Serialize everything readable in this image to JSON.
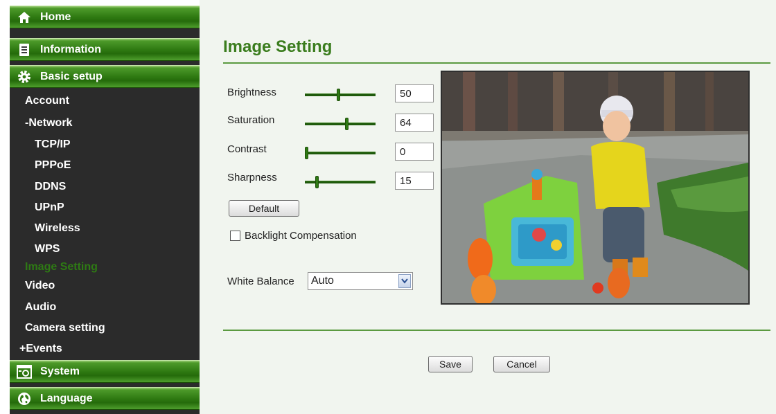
{
  "sidebar": {
    "home": "Home",
    "information": "Information",
    "basic_setup": "Basic setup",
    "items": {
      "account": "Account",
      "network": "-Network",
      "tcpip": "TCP/IP",
      "pppoe": "PPPoE",
      "ddns": "DDNS",
      "upnp": "UPnP",
      "wireless": "Wireless",
      "wps": "WPS",
      "image_setting": "Image Setting",
      "video": "Video",
      "audio": "Audio",
      "camera_setting": "Camera setting",
      "events": "+Events"
    },
    "system": "System",
    "language": "Language",
    "active_item": "image_setting"
  },
  "main": {
    "title": "Image Setting",
    "sliders": {
      "brightness": {
        "label": "Brightness",
        "value": "50",
        "fraction": 0.47
      },
      "saturation": {
        "label": "Saturation",
        "value": "64",
        "fraction": 0.6
      },
      "contrast": {
        "label": "Contrast",
        "value": "0",
        "fraction": 0.0
      },
      "sharpness": {
        "label": "Sharpness",
        "value": "15",
        "fraction": 0.15
      }
    },
    "default_button": "Default",
    "backlight_label": "Backlight Compensation",
    "backlight_checked": false,
    "white_balance_label": "White Balance",
    "white_balance_value": "Auto",
    "save_button": "Save",
    "cancel_button": "Cancel"
  },
  "colors": {
    "accent_green": "#3b7d1e",
    "sidebar_bg": "#2b2b2b",
    "active_item": "#2e7a14"
  }
}
